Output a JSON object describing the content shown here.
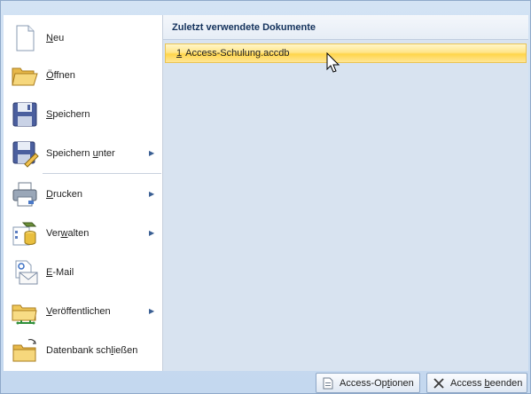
{
  "menu": {
    "items": [
      {
        "label_pre": "",
        "label_u": "N",
        "label_post": "eu",
        "arrow": false
      },
      {
        "label_pre": "",
        "label_u": "Ö",
        "label_post": "ffnen",
        "arrow": false
      },
      {
        "label_pre": "",
        "label_u": "S",
        "label_post": "peichern",
        "arrow": false
      },
      {
        "label_pre": "Speichern ",
        "label_u": "u",
        "label_post": "nter",
        "arrow": true
      },
      {
        "label_pre": "",
        "label_u": "D",
        "label_post": "rucken",
        "arrow": true
      },
      {
        "label_pre": "Ver",
        "label_u": "w",
        "label_post": "alten",
        "arrow": true
      },
      {
        "label_pre": "",
        "label_u": "E",
        "label_post": "-Mail",
        "arrow": false
      },
      {
        "label_pre": "",
        "label_u": "V",
        "label_post": "eröffentlichen",
        "arrow": true
      },
      {
        "label_pre": "Datenbank sch",
        "label_u": "l",
        "label_post": "ießen",
        "arrow": false
      }
    ],
    "arrow_glyph": "▶"
  },
  "panel": {
    "title": "Zuletzt verwendete Dokumente",
    "recent": [
      {
        "num": "1",
        "name": "Access-Schulung.accdb"
      }
    ]
  },
  "bottom": {
    "options": {
      "pre": "Access-Op",
      "u": "t",
      "post": "ionen"
    },
    "exit": {
      "pre": "Access ",
      "u": "b",
      "post": "eenden"
    }
  },
  "colors": {
    "accent": "#ffd54a",
    "frame": "#c4d8ef",
    "panel": "#d8e3f0"
  }
}
